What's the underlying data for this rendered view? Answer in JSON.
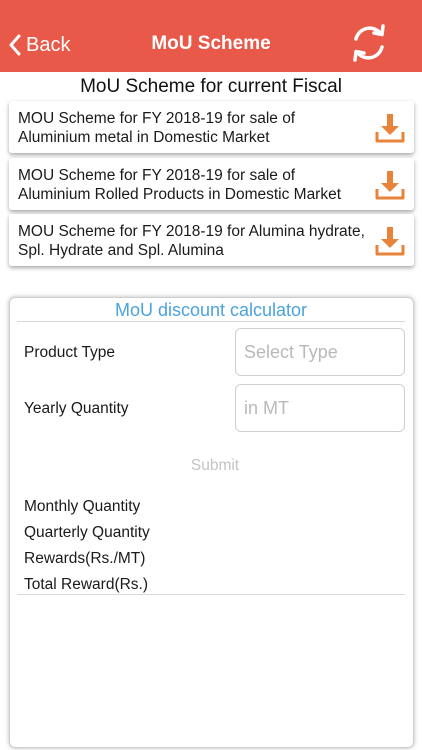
{
  "header": {
    "back_label": "Back",
    "title": "MoU Scheme",
    "color": "#e8594a"
  },
  "section_title": "MoU Scheme for current Fiscal",
  "schemes": [
    {
      "title": "MOU Scheme for FY 2018-19 for sale of Aluminium metal in Domestic Market",
      "icon": "download-icon"
    },
    {
      "title": "MOU Scheme for FY 2018-19 for sale of Aluminium Rolled Products in Domestic Market",
      "icon": "download-icon"
    },
    {
      "title": "MOU Scheme for FY 2018-19 for Alumina hydrate, Spl. Hydrate and Spl. Alumina",
      "icon": "download-icon"
    }
  ],
  "calculator": {
    "title": "MoU discount calculator",
    "title_color": "#4aa3df",
    "product_type_label": "Product Type",
    "product_type_placeholder": "Select Type",
    "yearly_quantity_label": "Yearly Quantity",
    "yearly_quantity_placeholder": "in MT",
    "submit_label": "Submit",
    "results": [
      "Monthly Quantity",
      "Quarterly Quantity",
      "Rewards(Rs./MT)",
      "Total Reward(Rs.)"
    ]
  },
  "accent_color": "#e8833a"
}
